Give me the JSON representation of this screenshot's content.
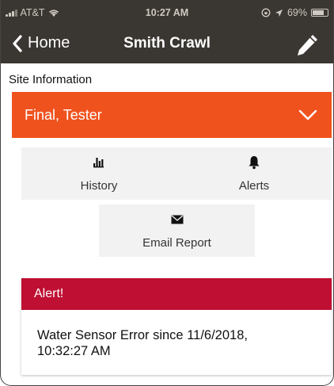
{
  "status_bar": {
    "carrier": "AT&T",
    "time": "10:27 AM",
    "battery": "69%",
    "battery_level": 0.69
  },
  "nav": {
    "back_label": "Home",
    "title": "Smith Crawl",
    "edit_icon": "pencil-icon"
  },
  "site_info": {
    "label": "Site Information",
    "selected_value": "Final, Tester"
  },
  "actions": {
    "history_label": "History",
    "alerts_label": "Alerts",
    "email_label": "Email Report"
  },
  "alert": {
    "title": "Alert!",
    "message_line1": "Water Sensor Error since 11/6/2018,",
    "message_line2": "10:32:27 AM"
  },
  "colors": {
    "header_bg": "#3a3631",
    "accent_orange": "#f0521e",
    "alert_red": "#bf0f32",
    "button_bg": "#f2f2f2"
  }
}
